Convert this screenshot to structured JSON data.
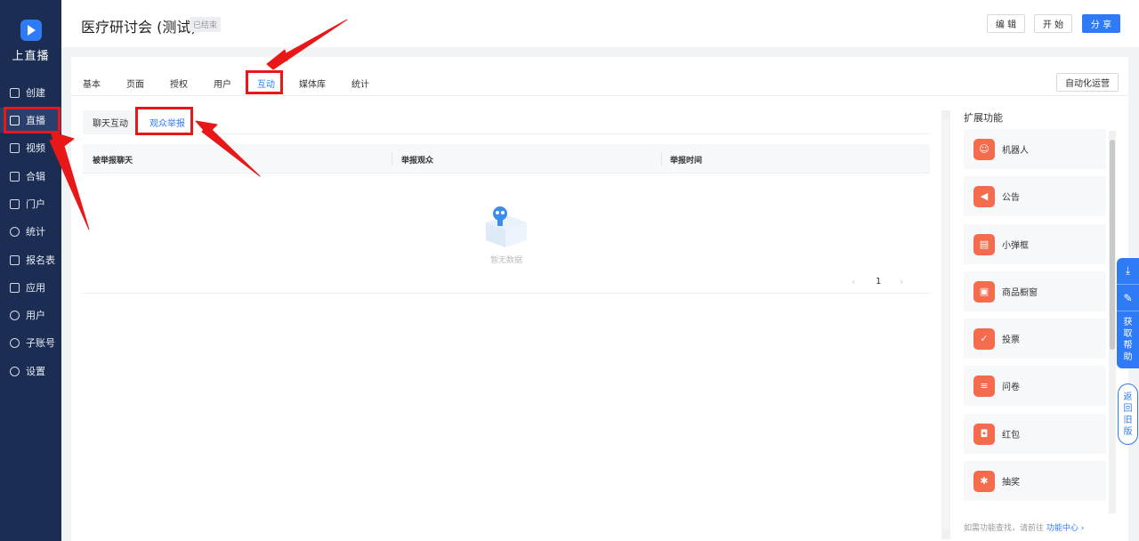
{
  "sidebar": {
    "brand": "上直播",
    "items": [
      {
        "label": "创建",
        "icon": "plus-square-icon"
      },
      {
        "label": "直播",
        "icon": "video-camera-icon"
      },
      {
        "label": "视频",
        "icon": "film-icon"
      },
      {
        "label": "合辑",
        "icon": "collection-icon"
      },
      {
        "label": "门户",
        "icon": "monitor-icon"
      },
      {
        "label": "统计",
        "icon": "pie-chart-icon"
      },
      {
        "label": "报名表",
        "icon": "form-icon"
      },
      {
        "label": "应用",
        "icon": "grid-apps-icon"
      },
      {
        "label": "用户",
        "icon": "users-icon"
      },
      {
        "label": "子账号",
        "icon": "sub-account-icon"
      },
      {
        "label": "设置",
        "icon": "gear-icon"
      }
    ]
  },
  "header": {
    "title": "医疗研讨会 (测试)",
    "status": "已结束",
    "buttons": {
      "edit": "编 辑",
      "start": "开 始",
      "share": "分 享"
    }
  },
  "tabs": [
    "基本",
    "页面",
    "授权",
    "用户",
    "互动",
    "媒体库",
    "统计"
  ],
  "auto_ops": "自动化运营",
  "subtabs": [
    "聊天互动",
    "观众举报"
  ],
  "table": {
    "columns": [
      "被举报聊天",
      "举报观众",
      "举报时间"
    ],
    "empty_text": "暂无数据",
    "page": "1"
  },
  "extensions": {
    "title": "扩展功能",
    "items": [
      {
        "label": "机器人",
        "icon": "robot-icon"
      },
      {
        "label": "公告",
        "icon": "megaphone-icon"
      },
      {
        "label": "小弹框",
        "icon": "popup-icon"
      },
      {
        "label": "商品橱窗",
        "icon": "cart-icon"
      },
      {
        "label": "投票",
        "icon": "vote-icon"
      },
      {
        "label": "问卷",
        "icon": "questionnaire-icon"
      },
      {
        "label": "红包",
        "icon": "red-envelope-icon"
      },
      {
        "label": "抽奖",
        "icon": "lottery-icon"
      }
    ],
    "footer_prefix": "如需功能查找，请前往",
    "footer_link": "功能中心 ›"
  },
  "float": {
    "help_text": "获取帮助",
    "old_version": "返回旧版"
  },
  "colors": {
    "accent": "#2f7bf5",
    "sidebar": "#1b2d52",
    "annotation": "#e81818",
    "extension_icon": "#f46b4d"
  }
}
